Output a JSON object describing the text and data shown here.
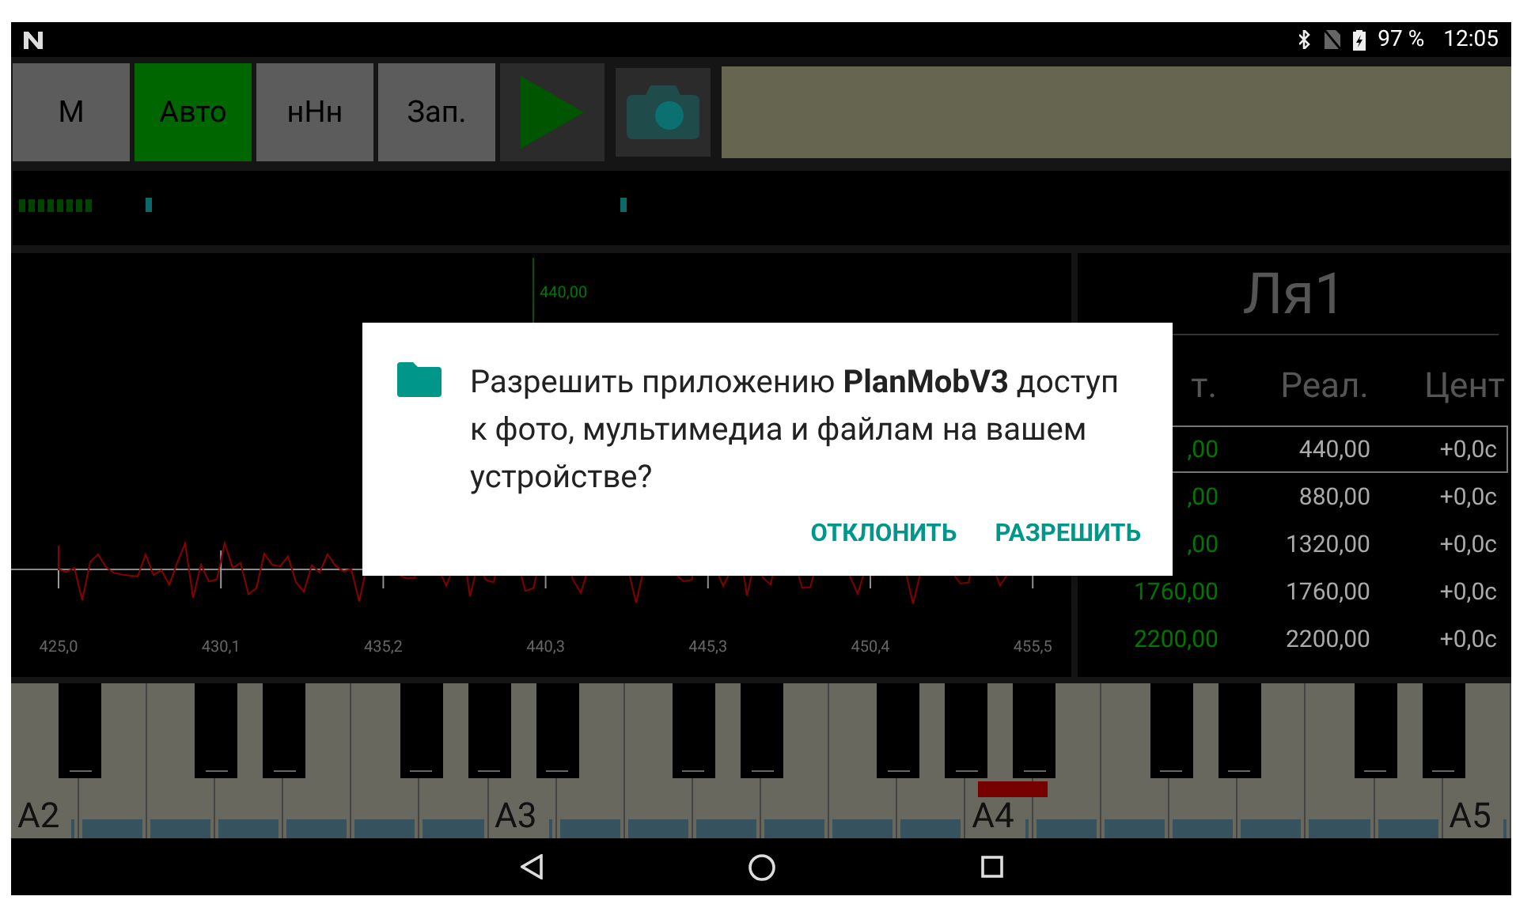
{
  "status_bar": {
    "battery": "97 %",
    "time": "12:05"
  },
  "toolbar": {
    "buttons": [
      {
        "kind": "text",
        "label": "М",
        "selected": false
      },
      {
        "kind": "text",
        "label": "Авто",
        "selected": true
      },
      {
        "kind": "text",
        "label": "нНн",
        "selected": false
      },
      {
        "kind": "text",
        "label": "Зап.",
        "selected": false
      },
      {
        "kind": "play",
        "selected": false
      },
      {
        "kind": "camera",
        "selected": false
      }
    ]
  },
  "spectrum": {
    "marker": "440,00",
    "ticks": [
      "425,0",
      "430,1",
      "435,2",
      "440,3",
      "445,3",
      "450,4",
      "455,5"
    ]
  },
  "note": {
    "name": "Ля1",
    "columns": [
      "т.",
      "Реал.",
      "Цент"
    ],
    "rows": [
      {
        "ideal": ",00",
        "real": "440,00",
        "cents": "+0,0c",
        "selected": true
      },
      {
        "ideal": ",00",
        "real": "880,00",
        "cents": "+0,0c",
        "selected": false
      },
      {
        "ideal": ",00",
        "real": "1320,00",
        "cents": "+0,0c",
        "selected": false
      },
      {
        "ideal": "1760,00",
        "real": "1760,00",
        "cents": "+0,0c",
        "selected": false
      },
      {
        "ideal": "2200,00",
        "real": "2200,00",
        "cents": "+0,0c",
        "selected": false
      }
    ]
  },
  "piano": {
    "keys": [
      {
        "label": "A2",
        "sharp": true,
        "selected": false
      },
      {
        "sharp": false,
        "selected": false
      },
      {
        "sharp": true,
        "selected": false
      },
      {
        "sharp": true,
        "selected": false
      },
      {
        "sharp": false,
        "selected": false
      },
      {
        "sharp": true,
        "selected": false
      },
      {
        "sharp": true,
        "selected": false
      },
      {
        "label": "A3",
        "sharp": true,
        "selected": false
      },
      {
        "sharp": false,
        "selected": false
      },
      {
        "sharp": true,
        "selected": false
      },
      {
        "sharp": true,
        "selected": false
      },
      {
        "sharp": false,
        "selected": false
      },
      {
        "sharp": true,
        "selected": false
      },
      {
        "sharp": true,
        "selected": false
      },
      {
        "label": "A4",
        "sharp": true,
        "selected": true
      },
      {
        "sharp": false,
        "selected": false
      },
      {
        "sharp": true,
        "selected": false
      },
      {
        "sharp": true,
        "selected": false
      },
      {
        "sharp": false,
        "selected": false
      },
      {
        "sharp": true,
        "selected": false
      },
      {
        "sharp": true,
        "selected": false
      },
      {
        "label": "A5",
        "sharp": false,
        "selected": false
      }
    ]
  },
  "dialog": {
    "message": "Разрешить приложению **PlanMobV3** доступ к фото, мультимедиа и файлам на вашем устройстве?",
    "buttons": [
      "ОТКЛОНИТЬ",
      "РАЗРЕШИТЬ"
    ]
  }
}
